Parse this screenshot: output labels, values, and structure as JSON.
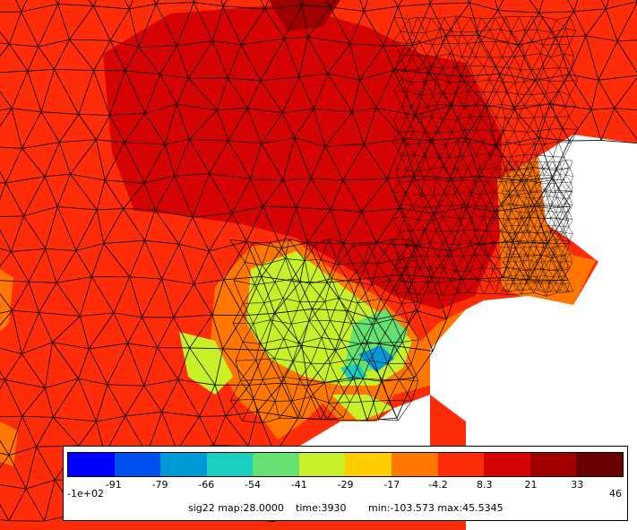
{
  "colormap": {
    "colors": [
      "#0000ff",
      "#0050f0",
      "#0099d8",
      "#19cfc0",
      "#66e070",
      "#c8f028",
      "#ffcc00",
      "#ff7700",
      "#ff2c0a",
      "#d50303",
      "#a00000",
      "#6a0000"
    ],
    "tick_labels": [
      "-91",
      "-79",
      "-66",
      "-54",
      "-41",
      "-29",
      "-17",
      "-4.2",
      "8.3",
      "21",
      "33"
    ],
    "min_label": "-1e+02",
    "max_label": "46"
  },
  "info": {
    "field": "sig22 map:28.0000",
    "time": "time:3930",
    "range": "min:-103.573 max:45.5345"
  }
}
